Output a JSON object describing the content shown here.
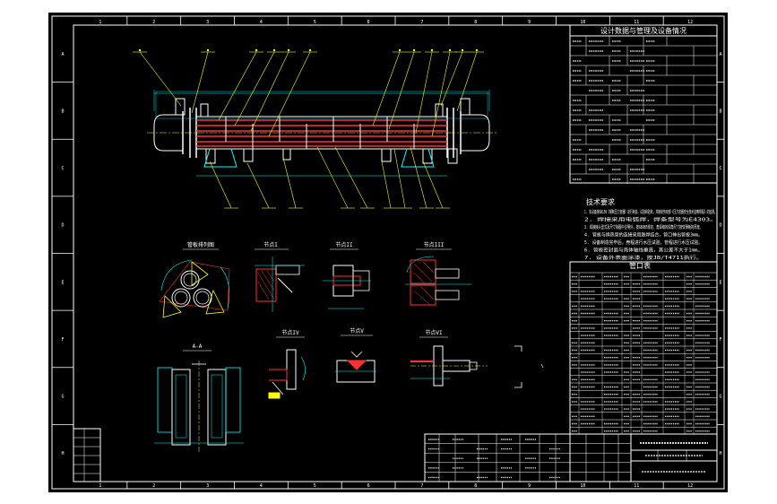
{
  "border": {
    "top_numbers": [
      "1",
      "2",
      "3",
      "4",
      "5",
      "6",
      "7",
      "8",
      "9",
      "10",
      "11",
      "12"
    ],
    "bottom_numbers": [
      "1",
      "2",
      "3",
      "4",
      "5",
      "6",
      "7",
      "8",
      "9",
      "10",
      "11",
      "12"
    ],
    "left_letters": [
      "A",
      "B",
      "C",
      "D",
      "E",
      "F",
      "G",
      "H"
    ],
    "right_letters": [
      "A",
      "B",
      "C",
      "D",
      "E",
      "F",
      "G",
      "H"
    ]
  },
  "spec_table": {
    "title": "设计数据与管理及设备情况"
  },
  "tech_requirements": {
    "title": "技术要求",
    "lines": [
      "1. 本设备按GB150《钢制压力容器》进行制造、试验和验收，并接受劳动部《压力容器安全技术监察规程》的监督。",
      "2. 焊接采用电弧焊，焊条型号为E4303。",
      "3. 焊接接头型式及尺寸除图中注明外，按GB985规定，角焊缝的焊角尺寸按较薄板的厚度。",
      "4. 管板与换热管的连接采用胀焊结合，管口伸出管板3mm。",
      "5. 设备制造完毕后，壳程进行水压试验，管程进行水压试验。",
      "6. 管板密封面与壳体轴线垂直，其公差不大于1mm。",
      "7. 设备外表面涂漆，按JB/T4711执行。"
    ]
  },
  "nozzle_table": {
    "title": "管口表"
  },
  "detail_views": [
    {
      "label": "管板排列图"
    },
    {
      "label": "节点I"
    },
    {
      "label": "节点II"
    },
    {
      "label": "节点III"
    },
    {
      "label": "A-A"
    },
    {
      "label": "节点IV"
    },
    {
      "label": "节点V"
    },
    {
      "label": "节点VI"
    }
  ],
  "colors": {
    "sheet": "#000000",
    "frame": "#ffffff",
    "cad_cyan": "#00ffff",
    "cad_yellow": "#ffff00",
    "cad_red": "#ff3030",
    "cad_magenta": "#ff00ff",
    "cad_green": "#00ff00"
  }
}
